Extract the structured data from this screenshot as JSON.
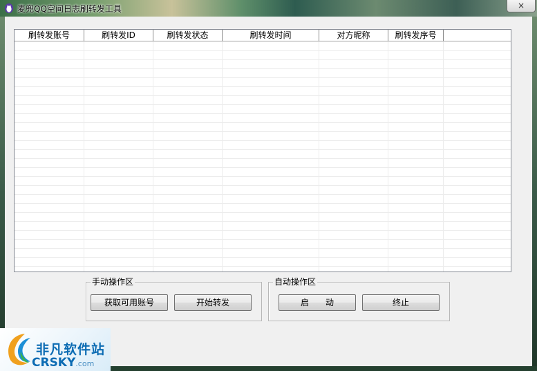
{
  "window": {
    "title": "麦兜QQ空间日志刷转发工具",
    "close_label": "×",
    "app_icon": "qq-penguin-icon"
  },
  "list": {
    "columns": [
      "刷转发账号",
      "刷转发ID",
      "刷转发状态",
      "刷转发时间",
      "对方昵称",
      "刷转发序号"
    ],
    "rows": []
  },
  "manual": {
    "title": "手动操作区",
    "get_accounts_label": "获取可用账号",
    "start_forward_label": "开始转发"
  },
  "auto": {
    "title": "自动操作区",
    "start_label": "启　　动",
    "stop_label": "终止"
  },
  "watermark": {
    "name": "非凡软件站",
    "domain": "CRSKY",
    "tld": ".com"
  }
}
